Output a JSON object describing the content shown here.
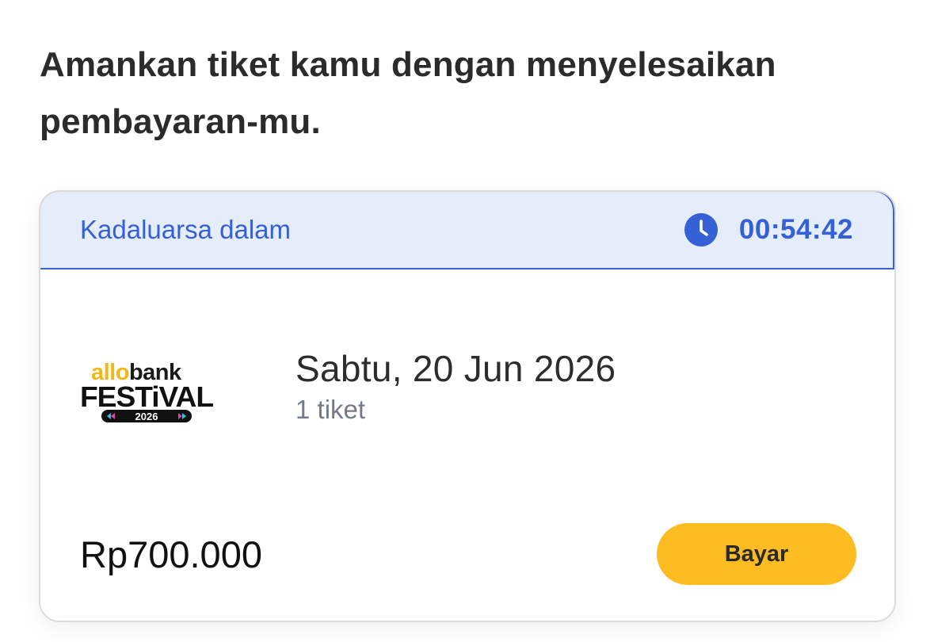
{
  "heading": "Amankan tiket kamu dengan menyelesaikan pembayaran-mu.",
  "expiry": {
    "label": "Kadaluarsa dalam",
    "icon": "clock-icon",
    "countdown": "00:54:42",
    "accent_color": "#3560d6",
    "background_color": "#e6edfa"
  },
  "event": {
    "logo": {
      "brand": "allobank",
      "allo_part": "allo",
      "bank_part": "bank",
      "title": "FESTiVAL",
      "year": "2026"
    },
    "date": "Sabtu, 20 Jun 2026",
    "quantity": "1 tiket"
  },
  "price": "Rp700.000",
  "pay_button": {
    "label": "Bayar",
    "color": "#fcbc22"
  }
}
